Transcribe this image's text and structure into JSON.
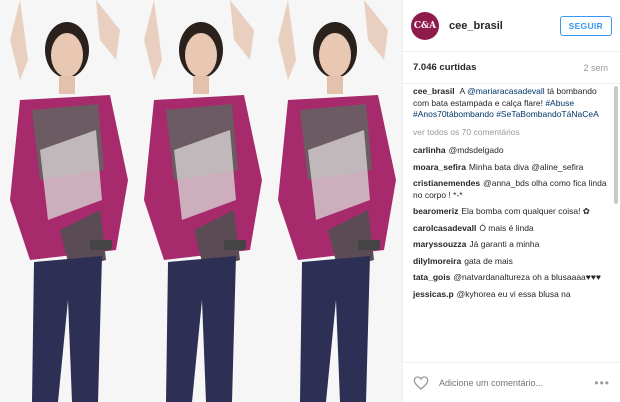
{
  "post": {
    "username": "cee_brasil",
    "avatar_text": "C&A",
    "follow_label": "SEGUIR",
    "likes": "7.046 curtidas",
    "time_ago": "2 sem",
    "caption": {
      "user": "cee_brasil",
      "text_1": "A",
      "mention": "@mariaracasadevall",
      "text_2": "tá bombando com bata estampada e calça flare!",
      "tag_1": "#Abuse",
      "tag_2": "#Anos70tábombando",
      "tag_3": "#SeTaBombandoTáNaCeA"
    },
    "view_all": "ver todos os 70 comentários",
    "comments": [
      {
        "user": "carlinha",
        "text": "@mdsdelgado"
      },
      {
        "user": "moara_sefira",
        "text": "Minha bata diva @aline_sefira"
      },
      {
        "user": "cristianemendes",
        "text": "@anna_bds olha como fica linda no corpo ! *-*"
      },
      {
        "user": "bearomeriz",
        "text": "Ela bomba com qualquer coisa! ✿"
      },
      {
        "user": "carolcasadevall",
        "text": "Ó mais é linda"
      },
      {
        "user": "maryssouzza",
        "text": "Já garanti a minha"
      },
      {
        "user": "dilylmoreira",
        "text": "gata de mais"
      },
      {
        "user": "tata_gois",
        "text": "@natvardanaltureza oh a blusaaaa♥♥♥"
      },
      {
        "user": "jessicas.p",
        "text": "@kyhorea eu vi essa blusa na"
      }
    ],
    "add_comment_placeholder": "Adicione um comentário...",
    "more_label": "•••"
  },
  "icons": {
    "heart": "heart-outline-icon",
    "more": "more-options-icon"
  }
}
